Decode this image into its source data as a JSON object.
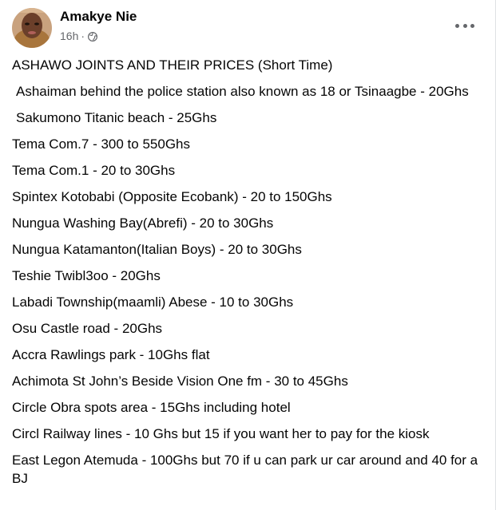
{
  "post": {
    "author": "Amakye Nie",
    "timestamp": "16h",
    "separator": "·",
    "privacy_icon": "globe-icon",
    "more_icon": "more-options-icon",
    "lines": [
      "ASHAWO JOINTS AND THEIR PRICES (Short Time)",
      "Ashaiman behind the police station also known as 18 or Tsinaagbe - 20Ghs",
      "Sakumono Titanic beach - 25Ghs",
      "Tema Com.7 - 300 to 550Ghs",
      "Tema Com.1 - 20 to 30Ghs",
      "Spintex Kotobabi (Opposite Ecobank) - 20 to 150Ghs",
      "Nungua Washing Bay(Abrefi) - 20 to 30Ghs",
      "Nungua Katamanton(Italian Boys) - 20 to 30Ghs",
      "Teshie Twibl3oo - 20Ghs",
      "Labadi Township(maamli) Abese - 10 to 30Ghs",
      "Osu Castle road - 20Ghs",
      "Accra Rawlings park - 10Ghs flat",
      "Achimota St John’s Beside Vision One fm - 30 to 45Ghs",
      "Circle Obra spots area - 15Ghs including hotel",
      "Circl Railway lines - 10 Ghs but 15 if you want her to pay for the kiosk",
      "East Legon Atemuda - 100Ghs but 70 if u can park ur car around and 40 for a BJ"
    ]
  }
}
